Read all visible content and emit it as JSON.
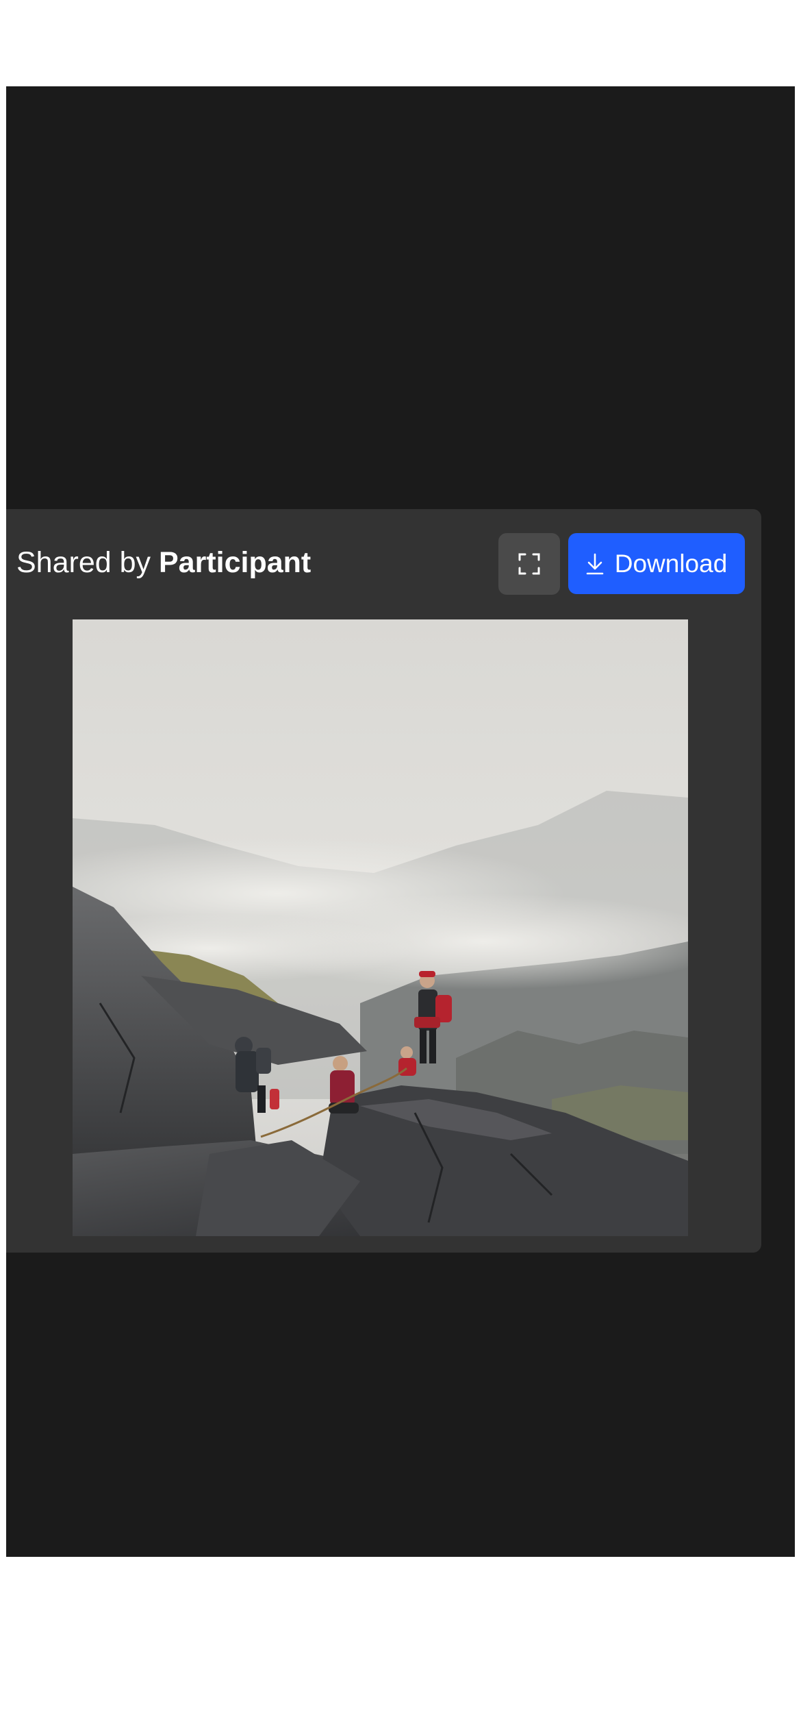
{
  "share_card": {
    "shared_by_prefix": "Shared by",
    "shared_by_name": "Participant",
    "fullscreen_icon": "expand-icon",
    "download_icon": "download-icon",
    "download_label": "Download"
  },
  "photo": {
    "subject": "hikers-on-rocky-mountain-ridge-in-fog"
  },
  "colors": {
    "viewer_background": "#1b1b1b",
    "card_background": "#333333",
    "fullscreen_button": "#4a4a4a",
    "accent": "#1f5eff",
    "text": "#ffffff"
  }
}
